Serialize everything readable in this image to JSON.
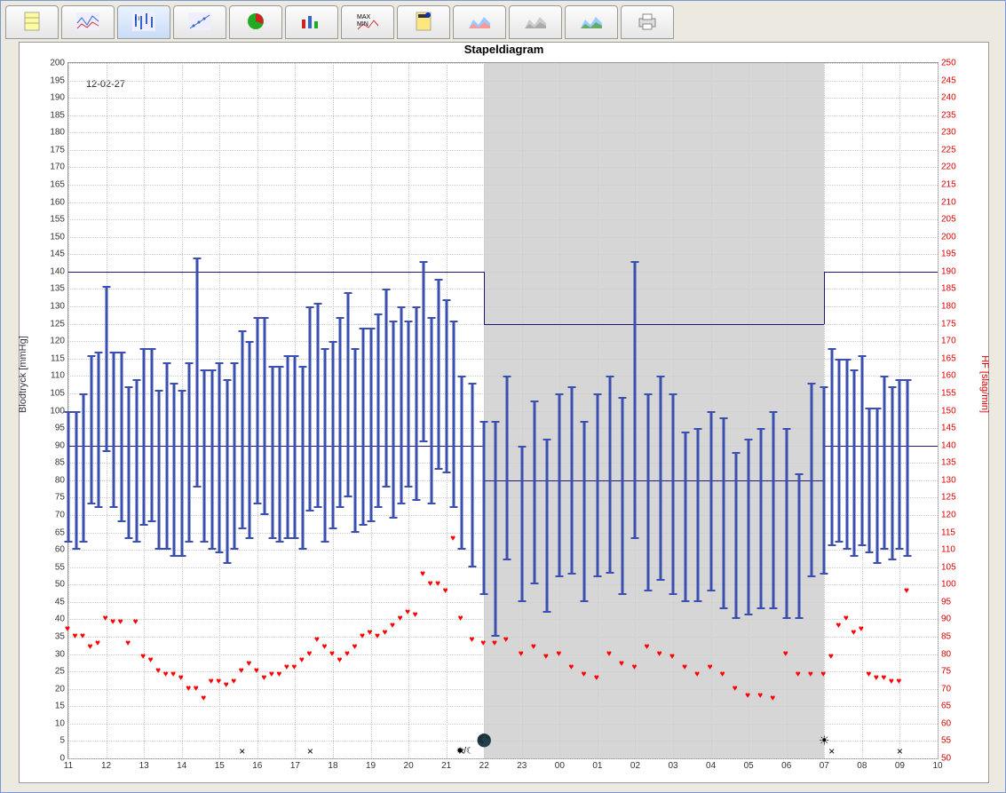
{
  "toolbar": {
    "buttons": [
      {
        "name": "table-icon",
        "label": "Table"
      },
      {
        "name": "line-chart-1-icon",
        "label": "Profile"
      },
      {
        "name": "bp-bars-icon",
        "label": "Stapel",
        "active": true
      },
      {
        "name": "scatter-icon",
        "label": "Correlation"
      },
      {
        "name": "pie-icon",
        "label": "Pie"
      },
      {
        "name": "bar-chart-icon",
        "label": "Histogram"
      },
      {
        "name": "maxmin-icon",
        "label": "Max/Min"
      },
      {
        "name": "calculator-icon",
        "label": "Stats"
      },
      {
        "name": "area-chart-1-icon",
        "label": "Compare1"
      },
      {
        "name": "area-chart-2-icon",
        "label": "Compare2"
      },
      {
        "name": "area-chart-3-icon",
        "label": "Compare3"
      },
      {
        "name": "print-icon",
        "label": "Print"
      }
    ]
  },
  "chart_data": {
    "type": "bar",
    "title": "Stapeldiagram",
    "date_annotation": "12-02-27",
    "xlabel": "",
    "ylabel_left": "Blodtryck [mmHg]",
    "ylabel_right": "HF [slag/min]",
    "ylim_left": [
      0,
      200
    ],
    "ylim_right": [
      50,
      250
    ],
    "x_ticks": [
      "11",
      "12",
      "13",
      "14",
      "15",
      "16",
      "17",
      "18",
      "19",
      "20",
      "21",
      "22",
      "23",
      "00",
      "01",
      "02",
      "03",
      "04",
      "05",
      "06",
      "07",
      "08",
      "09",
      "10"
    ],
    "night_shade": {
      "start": "22",
      "end": "07"
    },
    "limit_lines": {
      "day": {
        "upper": 140,
        "lower": 90
      },
      "night": {
        "upper": 125,
        "lower": 80
      }
    },
    "series": [
      {
        "name": "Blood pressure (Systolic/Diastolic)",
        "unit": "mmHg",
        "axis": "left",
        "style": "error-bar",
        "color": "#3a4fb0",
        "data": [
          {
            "t": 11.0,
            "sys": 100,
            "dia": 62
          },
          {
            "t": 11.2,
            "sys": 100,
            "dia": 60
          },
          {
            "t": 11.4,
            "sys": 105,
            "dia": 62
          },
          {
            "t": 11.6,
            "sys": 116,
            "dia": 73
          },
          {
            "t": 11.8,
            "sys": 117,
            "dia": 72
          },
          {
            "t": 12.0,
            "sys": 136,
            "dia": 88
          },
          {
            "t": 12.2,
            "sys": 117,
            "dia": 72
          },
          {
            "t": 12.4,
            "sys": 117,
            "dia": 68
          },
          {
            "t": 12.6,
            "sys": 107,
            "dia": 63
          },
          {
            "t": 12.8,
            "sys": 109,
            "dia": 62
          },
          {
            "t": 13.0,
            "sys": 118,
            "dia": 67
          },
          {
            "t": 13.2,
            "sys": 118,
            "dia": 68
          },
          {
            "t": 13.4,
            "sys": 106,
            "dia": 60
          },
          {
            "t": 13.6,
            "sys": 114,
            "dia": 60
          },
          {
            "t": 13.8,
            "sys": 108,
            "dia": 58
          },
          {
            "t": 14.0,
            "sys": 106,
            "dia": 58
          },
          {
            "t": 14.2,
            "sys": 114,
            "dia": 62
          },
          {
            "t": 14.4,
            "sys": 144,
            "dia": 78
          },
          {
            "t": 14.6,
            "sys": 112,
            "dia": 62
          },
          {
            "t": 14.8,
            "sys": 112,
            "dia": 60
          },
          {
            "t": 15.0,
            "sys": 114,
            "dia": 59
          },
          {
            "t": 15.2,
            "sys": 109,
            "dia": 56
          },
          {
            "t": 15.4,
            "sys": 114,
            "dia": 60
          },
          {
            "t": 15.6,
            "sys": 123,
            "dia": 66
          },
          {
            "t": 15.8,
            "sys": 120,
            "dia": 63
          },
          {
            "t": 16.0,
            "sys": 127,
            "dia": 73
          },
          {
            "t": 16.2,
            "sys": 127,
            "dia": 70
          },
          {
            "t": 16.4,
            "sys": 113,
            "dia": 63
          },
          {
            "t": 16.6,
            "sys": 113,
            "dia": 62
          },
          {
            "t": 16.8,
            "sys": 116,
            "dia": 63
          },
          {
            "t": 17.0,
            "sys": 116,
            "dia": 63
          },
          {
            "t": 17.2,
            "sys": 113,
            "dia": 60
          },
          {
            "t": 17.4,
            "sys": 130,
            "dia": 71
          },
          {
            "t": 17.6,
            "sys": 131,
            "dia": 72
          },
          {
            "t": 17.8,
            "sys": 118,
            "dia": 62
          },
          {
            "t": 18.0,
            "sys": 120,
            "dia": 66
          },
          {
            "t": 18.2,
            "sys": 127,
            "dia": 72
          },
          {
            "t": 18.4,
            "sys": 134,
            "dia": 75
          },
          {
            "t": 18.6,
            "sys": 118,
            "dia": 65
          },
          {
            "t": 18.8,
            "sys": 124,
            "dia": 67
          },
          {
            "t": 19.0,
            "sys": 124,
            "dia": 68
          },
          {
            "t": 19.2,
            "sys": 128,
            "dia": 72
          },
          {
            "t": 19.4,
            "sys": 135,
            "dia": 78
          },
          {
            "t": 19.6,
            "sys": 126,
            "dia": 69
          },
          {
            "t": 19.8,
            "sys": 130,
            "dia": 73
          },
          {
            "t": 20.0,
            "sys": 126,
            "dia": 78
          },
          {
            "t": 20.2,
            "sys": 130,
            "dia": 74
          },
          {
            "t": 20.4,
            "sys": 143,
            "dia": 91
          },
          {
            "t": 20.6,
            "sys": 127,
            "dia": 73
          },
          {
            "t": 20.8,
            "sys": 138,
            "dia": 83
          },
          {
            "t": 21.0,
            "sys": 132,
            "dia": 82
          },
          {
            "t": 21.2,
            "sys": 126,
            "dia": 72
          },
          {
            "t": 21.4,
            "sys": 110,
            "dia": 60
          },
          {
            "t": 21.7,
            "sys": 108,
            "dia": 55
          },
          {
            "t": 22.0,
            "sys": 97,
            "dia": 47
          },
          {
            "t": 22.3,
            "sys": 97,
            "dia": 35
          },
          {
            "t": 22.6,
            "sys": 110,
            "dia": 57
          },
          {
            "t": 23.0,
            "sys": 90,
            "dia": 45
          },
          {
            "t": 23.33,
            "sys": 103,
            "dia": 50
          },
          {
            "t": 23.66,
            "sys": 92,
            "dia": 42
          },
          {
            "t": 24.0,
            "sys": 105,
            "dia": 52
          },
          {
            "t": 24.33,
            "sys": 107,
            "dia": 53
          },
          {
            "t": 24.66,
            "sys": 97,
            "dia": 45
          },
          {
            "t": 25.0,
            "sys": 105,
            "dia": 52
          },
          {
            "t": 25.33,
            "sys": 110,
            "dia": 53
          },
          {
            "t": 25.66,
            "sys": 104,
            "dia": 47
          },
          {
            "t": 26.0,
            "sys": 143,
            "dia": 63
          },
          {
            "t": 26.33,
            "sys": 105,
            "dia": 48
          },
          {
            "t": 26.66,
            "sys": 110,
            "dia": 51
          },
          {
            "t": 27.0,
            "sys": 105,
            "dia": 47
          },
          {
            "t": 27.33,
            "sys": 94,
            "dia": 45
          },
          {
            "t": 27.66,
            "sys": 95,
            "dia": 45
          },
          {
            "t": 28.0,
            "sys": 100,
            "dia": 48
          },
          {
            "t": 28.33,
            "sys": 98,
            "dia": 43
          },
          {
            "t": 28.66,
            "sys": 88,
            "dia": 40
          },
          {
            "t": 29.0,
            "sys": 92,
            "dia": 41
          },
          {
            "t": 29.33,
            "sys": 95,
            "dia": 43
          },
          {
            "t": 29.66,
            "sys": 100,
            "dia": 43
          },
          {
            "t": 30.0,
            "sys": 95,
            "dia": 40
          },
          {
            "t": 30.33,
            "sys": 82,
            "dia": 40
          },
          {
            "t": 30.66,
            "sys": 108,
            "dia": 52
          },
          {
            "t": 31.0,
            "sys": 107,
            "dia": 53
          },
          {
            "t": 31.2,
            "sys": 118,
            "dia": 61
          },
          {
            "t": 31.4,
            "sys": 115,
            "dia": 62
          },
          {
            "t": 31.6,
            "sys": 115,
            "dia": 60
          },
          {
            "t": 31.8,
            "sys": 112,
            "dia": 58
          },
          {
            "t": 32.0,
            "sys": 116,
            "dia": 61
          },
          {
            "t": 32.2,
            "sys": 101,
            "dia": 59
          },
          {
            "t": 32.4,
            "sys": 101,
            "dia": 56
          },
          {
            "t": 32.6,
            "sys": 110,
            "dia": 60
          },
          {
            "t": 32.8,
            "sys": 107,
            "dia": 57
          },
          {
            "t": 33.0,
            "sys": 109,
            "dia": 60
          },
          {
            "t": 33.2,
            "sys": 109,
            "dia": 58
          }
        ]
      },
      {
        "name": "Heart rate",
        "unit": "slag/min",
        "axis": "right",
        "style": "heart",
        "color": "#ff0000",
        "data": [
          {
            "t": 11.0,
            "hr": 87
          },
          {
            "t": 11.2,
            "hr": 85
          },
          {
            "t": 11.4,
            "hr": 85
          },
          {
            "t": 11.6,
            "hr": 82
          },
          {
            "t": 11.8,
            "hr": 83
          },
          {
            "t": 12.0,
            "hr": 90
          },
          {
            "t": 12.2,
            "hr": 89
          },
          {
            "t": 12.4,
            "hr": 89
          },
          {
            "t": 12.6,
            "hr": 83
          },
          {
            "t": 12.8,
            "hr": 89
          },
          {
            "t": 13.0,
            "hr": 79
          },
          {
            "t": 13.2,
            "hr": 78
          },
          {
            "t": 13.4,
            "hr": 75
          },
          {
            "t": 13.6,
            "hr": 74
          },
          {
            "t": 13.8,
            "hr": 74
          },
          {
            "t": 14.0,
            "hr": 73
          },
          {
            "t": 14.2,
            "hr": 70
          },
          {
            "t": 14.4,
            "hr": 70
          },
          {
            "t": 14.6,
            "hr": 67
          },
          {
            "t": 14.8,
            "hr": 72
          },
          {
            "t": 15.0,
            "hr": 72
          },
          {
            "t": 15.2,
            "hr": 71
          },
          {
            "t": 15.4,
            "hr": 72
          },
          {
            "t": 15.6,
            "hr": 75
          },
          {
            "t": 15.8,
            "hr": 77
          },
          {
            "t": 16.0,
            "hr": 75
          },
          {
            "t": 16.2,
            "hr": 73
          },
          {
            "t": 16.4,
            "hr": 74
          },
          {
            "t": 16.6,
            "hr": 74
          },
          {
            "t": 16.8,
            "hr": 76
          },
          {
            "t": 17.0,
            "hr": 76
          },
          {
            "t": 17.2,
            "hr": 78
          },
          {
            "t": 17.4,
            "hr": 80
          },
          {
            "t": 17.6,
            "hr": 84
          },
          {
            "t": 17.8,
            "hr": 82
          },
          {
            "t": 18.0,
            "hr": 80
          },
          {
            "t": 18.2,
            "hr": 78
          },
          {
            "t": 18.4,
            "hr": 80
          },
          {
            "t": 18.6,
            "hr": 82
          },
          {
            "t": 18.8,
            "hr": 85
          },
          {
            "t": 19.0,
            "hr": 86
          },
          {
            "t": 19.2,
            "hr": 85
          },
          {
            "t": 19.4,
            "hr": 86
          },
          {
            "t": 19.6,
            "hr": 88
          },
          {
            "t": 19.8,
            "hr": 90
          },
          {
            "t": 20.0,
            "hr": 92
          },
          {
            "t": 20.2,
            "hr": 91
          },
          {
            "t": 20.4,
            "hr": 103
          },
          {
            "t": 20.6,
            "hr": 100
          },
          {
            "t": 20.8,
            "hr": 100
          },
          {
            "t": 21.0,
            "hr": 98
          },
          {
            "t": 21.2,
            "hr": 113
          },
          {
            "t": 21.4,
            "hr": 90
          },
          {
            "t": 21.7,
            "hr": 84
          },
          {
            "t": 22.0,
            "hr": 83
          },
          {
            "t": 22.3,
            "hr": 83
          },
          {
            "t": 22.6,
            "hr": 84
          },
          {
            "t": 23.0,
            "hr": 80
          },
          {
            "t": 23.33,
            "hr": 82
          },
          {
            "t": 23.66,
            "hr": 79
          },
          {
            "t": 24.0,
            "hr": 80
          },
          {
            "t": 24.33,
            "hr": 76
          },
          {
            "t": 24.66,
            "hr": 74
          },
          {
            "t": 25.0,
            "hr": 73
          },
          {
            "t": 25.33,
            "hr": 80
          },
          {
            "t": 25.66,
            "hr": 77
          },
          {
            "t": 26.0,
            "hr": 76
          },
          {
            "t": 26.33,
            "hr": 82
          },
          {
            "t": 26.66,
            "hr": 80
          },
          {
            "t": 27.0,
            "hr": 79
          },
          {
            "t": 27.33,
            "hr": 76
          },
          {
            "t": 27.66,
            "hr": 74
          },
          {
            "t": 28.0,
            "hr": 76
          },
          {
            "t": 28.33,
            "hr": 74
          },
          {
            "t": 28.66,
            "hr": 70
          },
          {
            "t": 29.0,
            "hr": 68
          },
          {
            "t": 29.33,
            "hr": 68
          },
          {
            "t": 29.66,
            "hr": 67
          },
          {
            "t": 30.0,
            "hr": 80
          },
          {
            "t": 30.33,
            "hr": 74
          },
          {
            "t": 30.66,
            "hr": 74
          },
          {
            "t": 31.0,
            "hr": 74
          },
          {
            "t": 31.2,
            "hr": 79
          },
          {
            "t": 31.4,
            "hr": 88
          },
          {
            "t": 31.6,
            "hr": 90
          },
          {
            "t": 31.8,
            "hr": 86
          },
          {
            "t": 32.0,
            "hr": 87
          },
          {
            "t": 32.2,
            "hr": 74
          },
          {
            "t": 32.4,
            "hr": 73
          },
          {
            "t": 32.6,
            "hr": 73
          },
          {
            "t": 32.8,
            "hr": 72
          },
          {
            "t": 33.0,
            "hr": 72
          },
          {
            "t": 33.2,
            "hr": 98
          }
        ]
      }
    ],
    "event_markers_x": [
      15.6,
      17.4,
      21.4,
      31.2,
      33.0
    ],
    "daynight_markers": [
      {
        "t": 22.0,
        "type": "moon"
      },
      {
        "t": 31.0,
        "type": "sun"
      }
    ]
  }
}
